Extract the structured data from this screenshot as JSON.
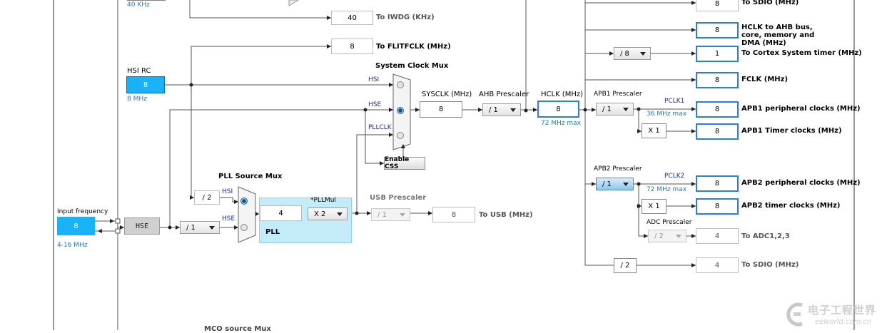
{
  "clock_tree": {
    "top_hz_note": "40 KHz",
    "iwdg": {
      "value": "40",
      "label": "To IWDG (KHz)"
    },
    "flitf": {
      "value": "8",
      "label": "To FLITFCLK (MHz)"
    },
    "hsi_rc": {
      "title": "HSI RC",
      "value": "8",
      "note": "8 MHz"
    },
    "input": {
      "title": "Input frequency",
      "value": "8",
      "range": "4-16 MHz"
    },
    "hse_block": "HSE",
    "hse_div": "/ 1",
    "hsi_div2": "/ 2",
    "pll_src_mux": {
      "title": "PLL Source Mux",
      "in_hsi": "HSI",
      "in_hse": "HSE"
    },
    "pll": {
      "label": "PLL",
      "mul_title": "*PLLMul",
      "input_value": "4",
      "mul": "X 2"
    },
    "usb": {
      "title": "USB Prescaler",
      "div": "/ 1",
      "value": "8",
      "label": "To USB (MHz)"
    },
    "sys_mux": {
      "title": "System Clock Mux",
      "in_hsi": "HSI",
      "in_hse": "HSE",
      "in_pll": "PLLCLK"
    },
    "css_button": "Enable CSS",
    "sysclk": {
      "title": "SYSCLK (MHz)",
      "value": "8"
    },
    "ahb": {
      "title": "AHB Prescaler",
      "div": "/ 1"
    },
    "hclk": {
      "title": "HCLK (MHz)",
      "value": "8",
      "max": "72 MHz max"
    },
    "outputs": [
      {
        "value": "8",
        "label": "To SDIO (MHz)"
      },
      {
        "value": "8",
        "label": "HCLK to AHB bus, core, memory and DMA (MHz)"
      },
      {
        "value": "1",
        "label": "To Cortex System timer (MHz)"
      },
      {
        "value": "8",
        "label": "FCLK (MHz)"
      }
    ],
    "cortex_div": "/ 8",
    "apb1": {
      "title": "APB1 Prescaler",
      "div": "/ 1",
      "pclk": "PCLK1",
      "max": "36 MHz max",
      "mult": "X 1",
      "periph": {
        "value": "8",
        "label": "APB1 peripheral clocks (MHz)"
      },
      "timer": {
        "value": "8",
        "label": "APB1 Timer clocks (MHz)"
      }
    },
    "apb2": {
      "title": "APB2 Prescaler",
      "div": "/ 1",
      "pclk": "PCLK2",
      "max": "72 MHz max",
      "mult": "X 1",
      "periph": {
        "value": "8",
        "label": "APB2 peripheral clocks (MHz)"
      },
      "timer": {
        "value": "8",
        "label": "APB2 timer clocks (MHz)"
      }
    },
    "adc": {
      "title": "ADC Prescaler",
      "div": "/ 2",
      "value": "4",
      "label": "To ADC1,2,3"
    },
    "sdio2": {
      "div": "/ 2",
      "value": "4",
      "label": "To SDIO (MHz)"
    },
    "mco": "MCO source Mux"
  },
  "watermark": {
    "cn": "电子工程世界",
    "en": "eeworld.com.cn"
  },
  "colors": {
    "accent_blue": "#2b7fd8",
    "hsi_fill": "#1ab2f7",
    "pll_fill": "#c3ebf8"
  }
}
